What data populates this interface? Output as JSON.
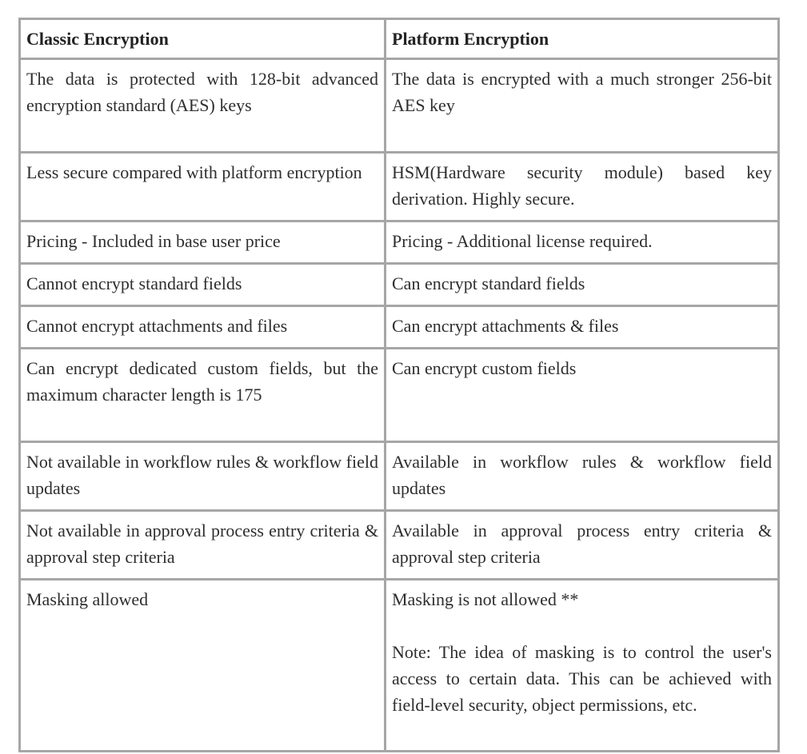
{
  "table": {
    "headers": [
      "Classic Encryption",
      "Platform Encryption"
    ],
    "rows": [
      {
        "classic": "The data is protected with 128-bit advanced encryption standard (AES) keys",
        "platform": "The data is encrypted with a much stronger 256-bit AES key"
      },
      {
        "classic": "Less secure compared with platform encryption",
        "platform": "HSM(Hardware security module) based key derivation. Highly secure."
      },
      {
        "classic": "Pricing - Included in base user price",
        "platform": "Pricing - Additional license required."
      },
      {
        "classic": "Cannot encrypt standard fields",
        "platform": "Can encrypt standard fields"
      },
      {
        "classic": "Cannot encrypt attachments and files",
        "platform": "Can encrypt attachments & files"
      },
      {
        "classic": "Can encrypt dedicated custom fields, but the maximum character length is 175",
        "platform": "Can encrypt custom fields"
      },
      {
        "classic": "Not available in workflow rules & workflow field updates",
        "platform": "Available in workflow rules & workflow field updates"
      },
      {
        "classic": "Not available in approval process entry criteria & approval step criteria",
        "platform": "Available in approval process entry criteria & approval step criteria"
      },
      {
        "classic": "Masking allowed",
        "platform": "Masking is not allowed **",
        "platform_note": "Note: The idea of masking is to control the user's access to certain data. This can be achieved with field-level security, object permissions, etc."
      }
    ]
  }
}
